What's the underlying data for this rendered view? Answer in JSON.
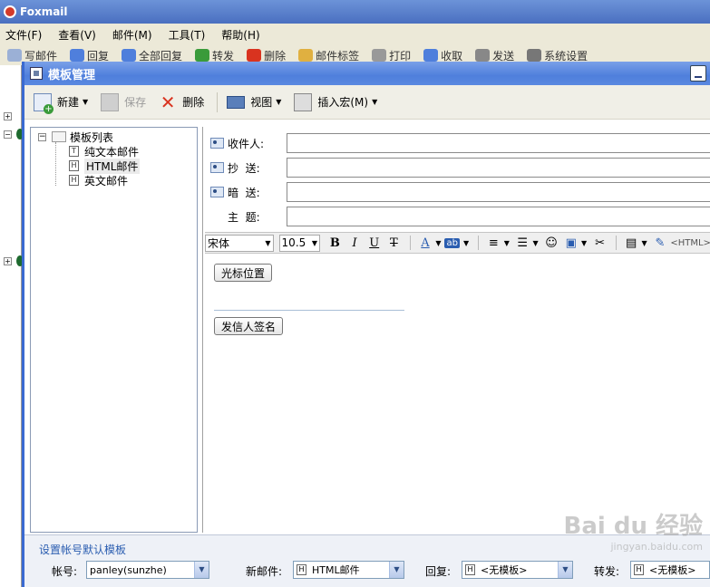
{
  "app": {
    "title": "Foxmail",
    "menu": [
      "文件(F)",
      "查看(V)",
      "邮件(M)",
      "工具(T)",
      "帮助(H)"
    ],
    "toolbar": [
      "写邮件",
      "回复",
      "全部回复",
      "转发",
      "删除",
      "邮件标签",
      "打印",
      "收取",
      "发送",
      "系统设置"
    ]
  },
  "dialog": {
    "title": "模板管理",
    "toolbar": {
      "new": "新建",
      "save": "保存",
      "delete": "删除",
      "view": "视图",
      "insert_macro": "插入宏(M)"
    },
    "tree": {
      "root": "模板列表",
      "items": [
        "纯文本邮件",
        "HTML邮件",
        "英文邮件"
      ],
      "item_icons": [
        "T",
        "H",
        "H"
      ],
      "selected_index": 1
    },
    "fields": {
      "to": "收件人:",
      "cc": "抄  送:",
      "bcc": "暗  送:",
      "subject": "主  题:"
    },
    "format": {
      "font": "宋体",
      "size": "10.5",
      "html_label": "<HTML>"
    },
    "body": {
      "cursor_button": "光标位置",
      "signature_button": "发信人签名"
    },
    "footer": {
      "section_title": "设置帐号默认模板",
      "account_label": "帐号:",
      "account_value": "panley(sunzhe)",
      "new_mail_label": "新邮件:",
      "new_mail_value": "HTML邮件",
      "reply_label": "回复:",
      "reply_value": "<无模板>",
      "forward_label": "转发:",
      "forward_value": "<无模板>"
    }
  },
  "watermark": {
    "brand": "Bai du 经验",
    "site": "jingyan.baidu.com"
  }
}
